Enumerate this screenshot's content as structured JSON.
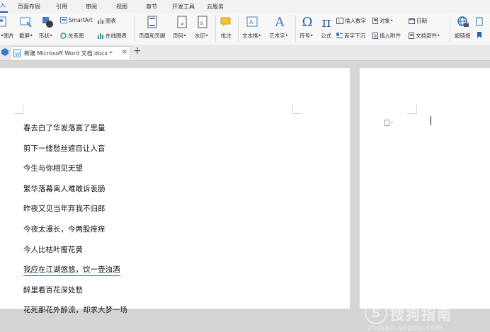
{
  "menubar": {
    "items": [
      "插入",
      "页面布局",
      "引用",
      "审阅",
      "视图",
      "章节",
      "开发工具",
      "云服务"
    ]
  },
  "ribbon": {
    "picture": "图片•",
    "screenshot": "截屏•",
    "shape": "形状•",
    "smartart": "SmartArt",
    "chart": "图表",
    "relation": "关系图",
    "online_chart": "在线图表",
    "header_footer": "页眉和页脚",
    "page_number": "页码•",
    "watermark": "水印•",
    "comment": "批注",
    "textbox": "文本框•",
    "wordart": "艺术字•",
    "symbol": "符号•",
    "formula": "公式",
    "insert_number": "插入数字",
    "object": "对象•",
    "date": "日期",
    "drop_cap": "首字下沉",
    "attachment": "插入附件",
    "doc_parts": "文档部件•",
    "hyperlink": "超链接",
    "sym_omega": "Ω",
    "sym_pi": "π",
    "sym_A": "A"
  },
  "tab": {
    "title": "新建 Microsoft Word 文档.docx *",
    "close": "×",
    "add": "+"
  },
  "document": {
    "lines": [
      "春去白了华发落寞了思量",
      "剪下一缕愁丝遮目让人盲",
      "今生与你相见无望",
      "繁华落幕离人难敢诉衷肠",
      "昨夜又见当年弃我不归郎",
      "今夜太漫长，今两股痒痒",
      "今人比枯叶瘦花黄",
      "我应在江湖悠悠，饮一壶浊酒",
      "醉里看百花深处愁",
      "花死那花外醉流，却求大梦一场"
    ],
    "underlined_line_index": 7
  },
  "watermark": {
    "logo_text": "S",
    "brand": "搜狗指南",
    "url": "zhinan.sogou.com"
  },
  "colors": {
    "accent": "#1a5fc2",
    "spellcheck": "#e0302e",
    "app_icon": "#2d7dd2"
  }
}
